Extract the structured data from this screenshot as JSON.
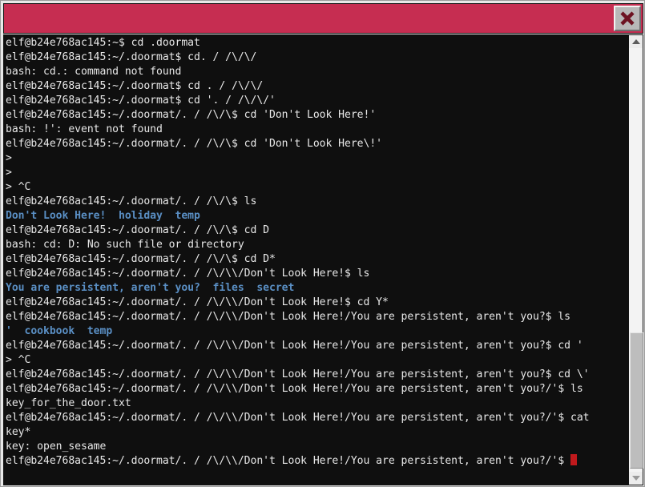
{
  "window": {
    "titlebar_label": "",
    "titlebar_color": "#c62d51",
    "close_icon": "close-x-icon"
  },
  "terminal": {
    "background": "#0f0f0f",
    "foreground": "#e8e8e8",
    "directory_color": "#5a8fc4",
    "cursor_color": "#c0191c",
    "lines": [
      {
        "kind": "out",
        "text": "elf@b24e768ac145:~$ cd .doormat"
      },
      {
        "kind": "out",
        "text": "elf@b24e768ac145:~/.doormat$ cd. / /\\/\\/"
      },
      {
        "kind": "out",
        "text": "bash: cd.: command not found"
      },
      {
        "kind": "out",
        "text": "elf@b24e768ac145:~/.doormat$ cd . / /\\/\\/"
      },
      {
        "kind": "out",
        "text": "elf@b24e768ac145:~/.doormat$ cd '. / /\\/\\/'"
      },
      {
        "kind": "out",
        "text": "elf@b24e768ac145:~/.doormat/. / /\\/\\$ cd 'Don't Look Here!'"
      },
      {
        "kind": "out",
        "text": "bash: !': event not found"
      },
      {
        "kind": "out",
        "text": "elf@b24e768ac145:~/.doormat/. / /\\/\\$ cd 'Don't Look Here\\!'"
      },
      {
        "kind": "out",
        "text": ">"
      },
      {
        "kind": "out",
        "text": ">"
      },
      {
        "kind": "out",
        "text": "> ^C"
      },
      {
        "kind": "out",
        "text": "elf@b24e768ac145:~/.doormat/. / /\\/\\$ ls"
      },
      {
        "kind": "dir",
        "text": "Don't Look Here!  holiday  temp"
      },
      {
        "kind": "out",
        "text": "elf@b24e768ac145:~/.doormat/. / /\\/\\$ cd D"
      },
      {
        "kind": "out",
        "text": "bash: cd: D: No such file or directory"
      },
      {
        "kind": "out",
        "text": "elf@b24e768ac145:~/.doormat/. / /\\/\\$ cd D*"
      },
      {
        "kind": "out",
        "text": "elf@b24e768ac145:~/.doormat/. / /\\/\\\\/Don't Look Here!$ ls"
      },
      {
        "kind": "dir",
        "text": "You are persistent, aren't you?  files  secret"
      },
      {
        "kind": "out",
        "text": "elf@b24e768ac145:~/.doormat/. / /\\/\\\\/Don't Look Here!$ cd Y*"
      },
      {
        "kind": "out",
        "text": "elf@b24e768ac145:~/.doormat/. / /\\/\\\\/Don't Look Here!/You are persistent, aren't you?$ ls"
      },
      {
        "kind": "dir",
        "text": "'  cookbook  temp"
      },
      {
        "kind": "out",
        "text": "elf@b24e768ac145:~/.doormat/. / /\\/\\\\/Don't Look Here!/You are persistent, aren't you?$ cd '"
      },
      {
        "kind": "out",
        "text": "> ^C"
      },
      {
        "kind": "out",
        "text": "elf@b24e768ac145:~/.doormat/. / /\\/\\\\/Don't Look Here!/You are persistent, aren't you?$ cd \\'"
      },
      {
        "kind": "out",
        "text": "elf@b24e768ac145:~/.doormat/. / /\\/\\\\/Don't Look Here!/You are persistent, aren't you?/'$ ls"
      },
      {
        "kind": "out",
        "text": "key_for_the_door.txt"
      },
      {
        "kind": "out",
        "text": "elf@b24e768ac145:~/.doormat/. / /\\/\\\\/Don't Look Here!/You are persistent, aren't you?/'$ cat"
      },
      {
        "kind": "out",
        "text": "key*"
      },
      {
        "kind": "out",
        "text": "key: open_sesame"
      },
      {
        "kind": "prompt_cursor",
        "text": "elf@b24e768ac145:~/.doormat/. / /\\/\\\\/Don't Look Here!/You are persistent, aren't you?/'$ "
      }
    ]
  },
  "scrollbar": {
    "up_icon": "triangle-up-icon",
    "down_icon": "triangle-down-icon",
    "thumb_name": "scrollbar-thumb"
  }
}
